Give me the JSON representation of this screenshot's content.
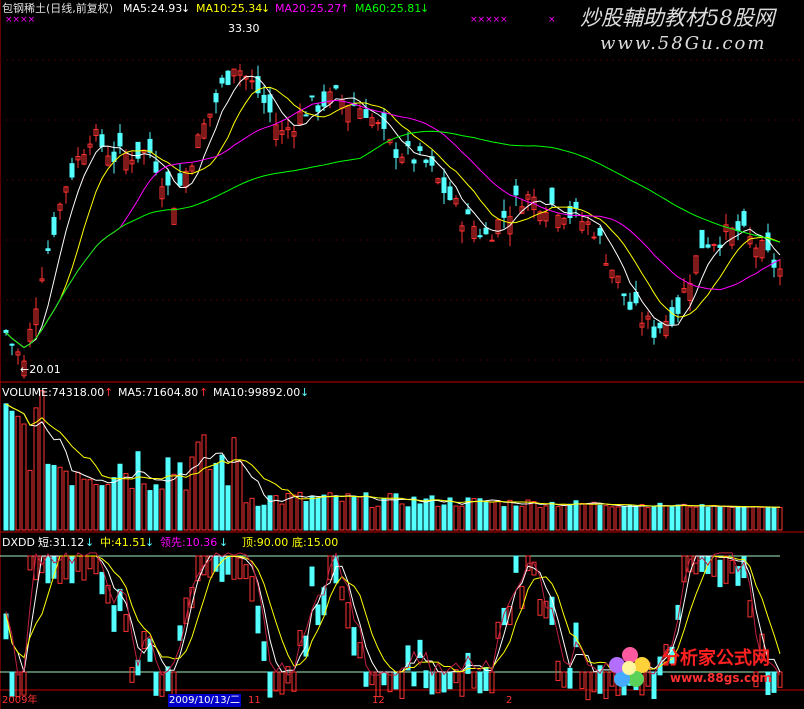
{
  "header": {
    "title": "包钢稀土(日线,前复权)",
    "ma5": "MA5:24.93",
    "ma5_arrow": "↓",
    "ma10": "MA10:25.34",
    "ma10_arrow": "↓",
    "ma20": "MA20:25.27",
    "ma20_arrow": "↑",
    "ma60": "MA60:25.81",
    "ma60_arrow": "↓",
    "marker_left": "××××",
    "marker_mid": "×××××",
    "marker_right": "×"
  },
  "watermark": {
    "line1": "炒股輔助教材58股网",
    "line2": "www.58Gu.com"
  },
  "price_labels": {
    "high": "33.30",
    "low": "←20.01"
  },
  "volume_header": {
    "volume": "VOLUME:74318.00",
    "volume_arrow": "↑",
    "ma5": "MA5:71604.80",
    "ma5_arrow": "↑",
    "ma10": "MA10:99892.00",
    "ma10_arrow": "↓"
  },
  "indicator_header": {
    "name": "DXDD",
    "short": "短:31.12",
    "short_arrow": "↓",
    "mid": "中:41.51",
    "mid_arrow": "↓",
    "lead": "领先:10.36",
    "lead_arrow": "↓",
    "top": "顶:90.00",
    "bottom": "底:15.00"
  },
  "date_axis": {
    "left": "2009年",
    "cursor": "2009/10/13/二",
    "after_cursor": "11",
    "mark1": "12",
    "mark2": "2"
  },
  "logo": {
    "text": "分析家公式网",
    "url": "www.88gs.com"
  },
  "colors": {
    "up": "#ff3232",
    "down": "#54ffff",
    "ma5": "#ffffff",
    "ma10": "#ffff00",
    "ma20": "#ff00ff",
    "ma60": "#00ff00",
    "frame": "#c00000"
  },
  "chart_data": {
    "type": "candlestick",
    "title": "包钢稀土(日线,前复权)",
    "price_range": [
      19.5,
      34.5
    ],
    "annotated_high": 33.3,
    "annotated_low": 20.01,
    "moving_averages": {
      "MA5": 24.93,
      "MA10": 25.34,
      "MA20": 25.27,
      "MA60": 25.81
    },
    "volume_latest": 74318.0,
    "volume_ma5": 71604.8,
    "volume_ma10": 99892.0,
    "indicator_DXDD": {
      "short": 31.12,
      "mid": 41.51,
      "lead": 10.36,
      "top": 90.0,
      "bottom": 15.0
    }
  }
}
